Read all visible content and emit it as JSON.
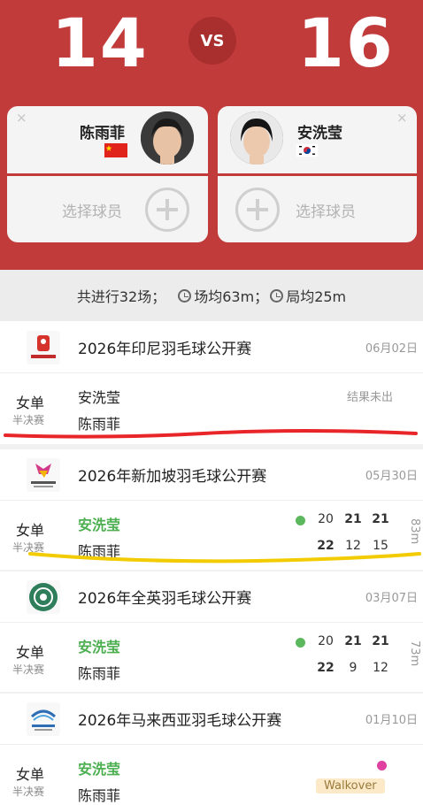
{
  "header": {
    "left_score": "14",
    "right_score": "16",
    "vs_label": "VS",
    "left_player": {
      "name": "陈雨菲",
      "flag": "china-flag"
    },
    "right_player": {
      "name": "安洗莹",
      "flag": "korea-flag"
    },
    "select_player_label": "选择球员",
    "close_symbol": "×"
  },
  "stats": {
    "total": "共进行32场；",
    "avg_match": "场均63m；",
    "avg_game": "局均25m"
  },
  "tournaments": [
    {
      "name": "2026年印尼羽毛球公开赛",
      "date": "06月02日",
      "logo": "polytron-logo",
      "event": "女单",
      "round": "半决赛",
      "player1": "安洗莹",
      "player2": "陈雨菲",
      "status": "结果未出"
    },
    {
      "name": "2026年新加坡羽毛球公开赛",
      "date": "05月30日",
      "logo": "singapore-open-logo",
      "event": "女单",
      "round": "半决赛",
      "player1": "安洗莹",
      "player2": "陈雨菲",
      "p1_scores": [
        "20",
        "21",
        "21"
      ],
      "p2_scores": [
        "22",
        "12",
        "15"
      ],
      "duration": "83m"
    },
    {
      "name": "2026年全英羽毛球公开赛",
      "date": "03月07日",
      "logo": "all-england-logo",
      "event": "女单",
      "round": "半决赛",
      "player1": "安洗莹",
      "player2": "陈雨菲",
      "p1_scores": [
        "20",
        "21",
        "21"
      ],
      "p2_scores": [
        "22",
        "9",
        "12"
      ],
      "duration": "73m"
    },
    {
      "name": "2026年马来西亚羽毛球公开赛",
      "date": "01月10日",
      "logo": "malaysia-open-logo",
      "event": "女单",
      "round": "半决赛",
      "player1": "安洗莹",
      "player2": "陈雨菲",
      "badge": "Walkover"
    }
  ],
  "colors": {
    "header_red": "#c23b3b",
    "winner_green": "#4caf50",
    "dot_green": "#5cb85c",
    "dot_pink": "#e040a0",
    "annotation_red": "#e8262a",
    "annotation_yellow": "#f2cc00"
  }
}
